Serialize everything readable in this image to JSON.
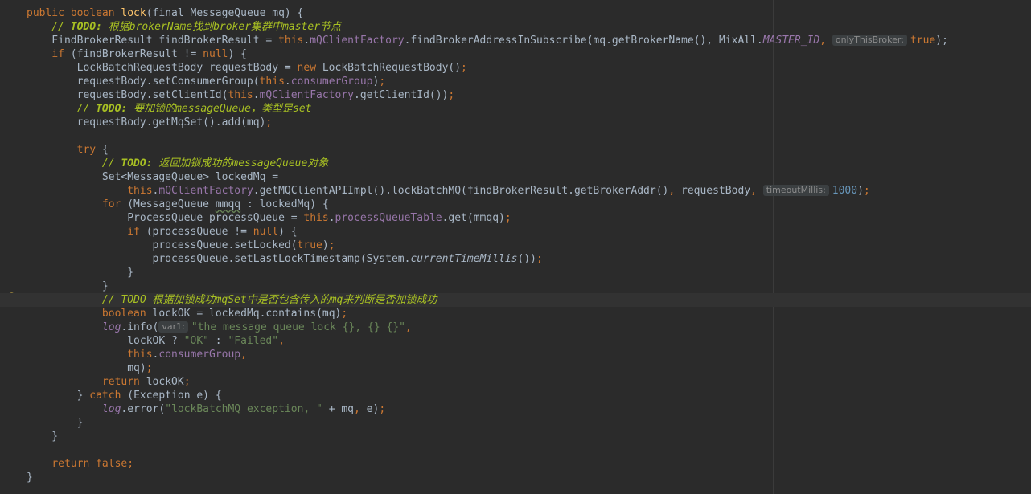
{
  "editor": {
    "language": "Java",
    "theme": "Darcula",
    "caret_line": 22
  },
  "icons": [
    "lightbulb-icon"
  ],
  "colors": {
    "background": "#2b2b2b",
    "keyword": "#cc7832",
    "method_decl": "#ffc66d",
    "field": "#9876aa",
    "number": "#6897bb",
    "string": "#6a8759",
    "comment": "#808080",
    "todo": "#a8c023"
  },
  "lines": [
    [
      [
        "kw",
        "public boolean "
      ],
      [
        "fn",
        "lock"
      ],
      [
        "t",
        "(final MessageQueue mq) {"
      ]
    ],
    [
      [
        "t",
        "    "
      ],
      [
        "todo",
        "// "
      ],
      [
        "todo-b",
        "TODO: "
      ],
      [
        "todo",
        "根据"
      ],
      [
        "todo",
        "brokerName"
      ],
      [
        "todo",
        "找到"
      ],
      [
        "todo",
        "broker"
      ],
      [
        "todo",
        "集群中"
      ],
      [
        "todo",
        "master"
      ],
      [
        "todo",
        "节点"
      ]
    ],
    [
      [
        "t",
        "    FindBrokerResult findBrokerResult = "
      ],
      [
        "kw",
        "this"
      ],
      [
        "t",
        "."
      ],
      [
        "fld",
        "mQClientFactory"
      ],
      [
        "t",
        ".findBrokerAddressInSubscribe(mq.getBrokerName(), MixAll."
      ],
      [
        "ifld",
        "MASTER_ID"
      ],
      [
        "kw",
        ", "
      ],
      [
        "hint",
        "onlyThisBroker:"
      ],
      [
        "kw",
        "true"
      ],
      [
        "t",
        ");"
      ]
    ],
    [
      [
        "t",
        "    "
      ],
      [
        "kw",
        "if "
      ],
      [
        "t",
        "(findBrokerResult != "
      ],
      [
        "kw",
        "null"
      ],
      [
        "t",
        ") {"
      ]
    ],
    [
      [
        "t",
        "        LockBatchRequestBody requestBody = "
      ],
      [
        "kw",
        "new "
      ],
      [
        "t",
        "LockBatchRequestBody()"
      ],
      [
        "kw",
        ";"
      ]
    ],
    [
      [
        "t",
        "        requestBody.setConsumerGroup("
      ],
      [
        "kw",
        "this"
      ],
      [
        "t",
        "."
      ],
      [
        "fld",
        "consumerGroup"
      ],
      [
        "t",
        ")"
      ],
      [
        "kw",
        ";"
      ]
    ],
    [
      [
        "t",
        "        requestBody.setClientId("
      ],
      [
        "kw",
        "this"
      ],
      [
        "t",
        "."
      ],
      [
        "fld",
        "mQClientFactory"
      ],
      [
        "t",
        ".getClientId())"
      ],
      [
        "kw",
        ";"
      ]
    ],
    [
      [
        "t",
        "        "
      ],
      [
        "todo",
        "// "
      ],
      [
        "todo-b",
        "TODO: "
      ],
      [
        "todo",
        "要加锁的"
      ],
      [
        "todo",
        "messageQueue"
      ],
      [
        "todo",
        "，类型是"
      ],
      [
        "todo",
        "set"
      ]
    ],
    [
      [
        "t",
        "        requestBody.getMqSet().add(mq)"
      ],
      [
        "kw",
        ";"
      ]
    ],
    [
      [
        "t",
        ""
      ]
    ],
    [
      [
        "t",
        "        "
      ],
      [
        "kw",
        "try "
      ],
      [
        "t",
        "{"
      ]
    ],
    [
      [
        "t",
        "            "
      ],
      [
        "todo",
        "// "
      ],
      [
        "todo-b",
        "TODO: "
      ],
      [
        "todo",
        "返回加锁成功的"
      ],
      [
        "todo",
        "messageQueue"
      ],
      [
        "todo",
        "对象"
      ]
    ],
    [
      [
        "t",
        "            Set<MessageQueue> lockedMq ="
      ]
    ],
    [
      [
        "t",
        "                "
      ],
      [
        "kw",
        "this"
      ],
      [
        "t",
        "."
      ],
      [
        "fld",
        "mQClientFactory"
      ],
      [
        "t",
        ".getMQClientAPIImpl().lockBatchMQ(findBrokerResult.getBrokerAddr()"
      ],
      [
        "kw",
        ", "
      ],
      [
        "t",
        "requestBody"
      ],
      [
        "kw",
        ", "
      ],
      [
        "hint",
        "timeoutMillis:"
      ],
      [
        "num",
        "1000"
      ],
      [
        "t",
        ")"
      ],
      [
        "kw",
        ";"
      ]
    ],
    [
      [
        "t",
        "            "
      ],
      [
        "kw",
        "for "
      ],
      [
        "t",
        "(MessageQueue "
      ],
      [
        "sq",
        "mmqq"
      ],
      [
        "t",
        " : lockedMq) {"
      ]
    ],
    [
      [
        "t",
        "                ProcessQueue processQueue = "
      ],
      [
        "kw",
        "this"
      ],
      [
        "t",
        "."
      ],
      [
        "fld",
        "processQueueTable"
      ],
      [
        "t",
        ".get(mmqq)"
      ],
      [
        "kw",
        ";"
      ]
    ],
    [
      [
        "t",
        "                "
      ],
      [
        "kw",
        "if "
      ],
      [
        "t",
        "(processQueue != "
      ],
      [
        "kw",
        "null"
      ],
      [
        "t",
        ") {"
      ]
    ],
    [
      [
        "t",
        "                    processQueue.setLocked("
      ],
      [
        "kw",
        "true"
      ],
      [
        "t",
        ")"
      ],
      [
        "kw",
        ";"
      ]
    ],
    [
      [
        "t",
        "                    processQueue.setLastLockTimestamp(System."
      ],
      [
        "ital",
        "currentTimeMillis"
      ],
      [
        "t",
        "())"
      ],
      [
        "kw",
        ";"
      ]
    ],
    [
      [
        "t",
        "                }"
      ]
    ],
    [
      [
        "t",
        "            }"
      ]
    ],
    [
      [
        "t",
        "            "
      ],
      [
        "todo",
        "// TODO "
      ],
      [
        "todo",
        "根据加锁成功"
      ],
      [
        "todo",
        "mqSet"
      ],
      [
        "todo",
        "中是否包含传入的"
      ],
      [
        "todo",
        "mq"
      ],
      [
        "todo",
        "来判断是否加锁成功"
      ],
      [
        "caret",
        ""
      ]
    ],
    [
      [
        "t",
        "            "
      ],
      [
        "kw",
        "boolean "
      ],
      [
        "t",
        "lockOK = lockedMq.contains(mq)"
      ],
      [
        "kw",
        ";"
      ]
    ],
    [
      [
        "t",
        "            "
      ],
      [
        "ifld",
        "log"
      ],
      [
        "t",
        ".info("
      ],
      [
        "hint",
        "var1:"
      ],
      [
        "str",
        "\"the message queue lock {}, {} {}\""
      ],
      [
        "kw",
        ","
      ]
    ],
    [
      [
        "t",
        "                lockOK ? "
      ],
      [
        "str",
        "\"OK\""
      ],
      [
        "t",
        " : "
      ],
      [
        "str",
        "\"Failed\""
      ],
      [
        "kw",
        ","
      ]
    ],
    [
      [
        "t",
        "                "
      ],
      [
        "kw",
        "this"
      ],
      [
        "t",
        "."
      ],
      [
        "fld",
        "consumerGroup"
      ],
      [
        "kw",
        ","
      ]
    ],
    [
      [
        "t",
        "                mq)"
      ],
      [
        "kw",
        ";"
      ]
    ],
    [
      [
        "t",
        "            "
      ],
      [
        "kw",
        "return "
      ],
      [
        "t",
        "lockOK"
      ],
      [
        "kw",
        ";"
      ]
    ],
    [
      [
        "t",
        "        } "
      ],
      [
        "kw",
        "catch "
      ],
      [
        "t",
        "(Exception e) {"
      ]
    ],
    [
      [
        "t",
        "            "
      ],
      [
        "ifld",
        "log"
      ],
      [
        "t",
        ".error("
      ],
      [
        "str",
        "\"lockBatchMQ exception, \""
      ],
      [
        "t",
        " + mq"
      ],
      [
        "kw",
        ", "
      ],
      [
        "t",
        "e)"
      ],
      [
        "kw",
        ";"
      ]
    ],
    [
      [
        "t",
        "        }"
      ]
    ],
    [
      [
        "t",
        "    }"
      ]
    ],
    [
      [
        "t",
        ""
      ]
    ],
    [
      [
        "t",
        "    "
      ],
      [
        "kw",
        "return false;"
      ]
    ],
    [
      [
        "t",
        "}"
      ]
    ]
  ]
}
